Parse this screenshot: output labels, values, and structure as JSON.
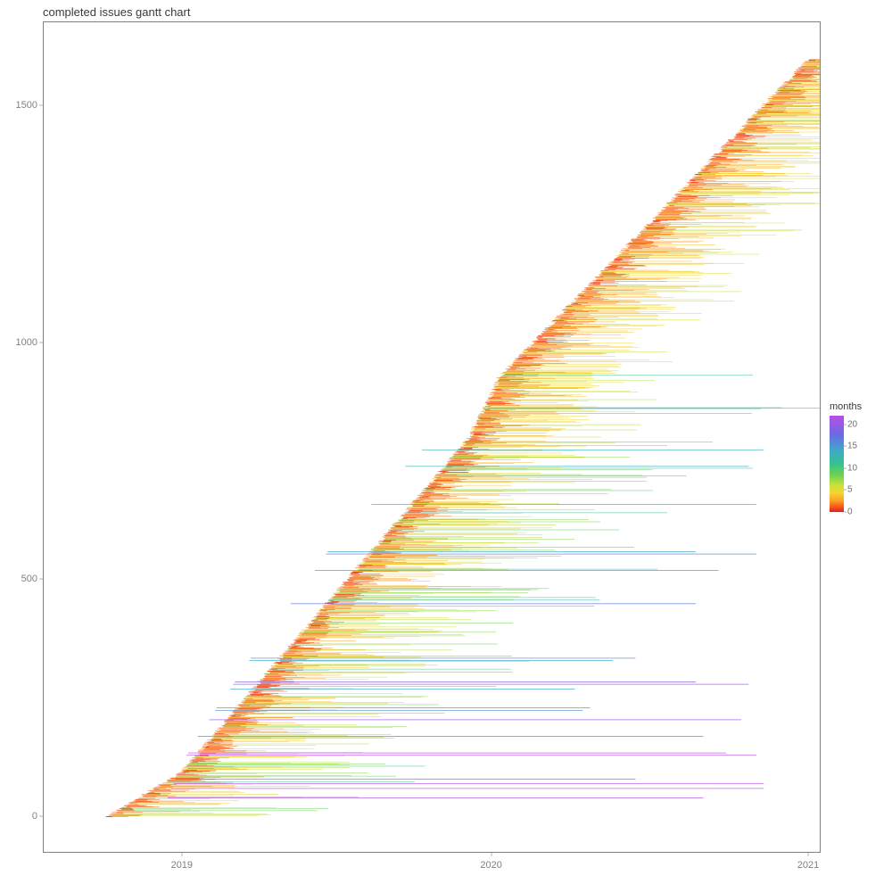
{
  "chart_data": {
    "type": "gantt",
    "title": "completed issues gantt chart",
    "xlabel": "",
    "ylabel": "",
    "x_ticks": [
      "2019",
      "2020",
      "2021"
    ],
    "x_tick_values": [
      0.17,
      0.58,
      1.0
    ],
    "y_ticks": [
      "0",
      "500",
      "1000",
      "1500"
    ],
    "y_tick_values": [
      0,
      500,
      1000,
      1500
    ],
    "ylim": [
      -40,
      1640
    ],
    "legend": {
      "title": "months",
      "ticks": [
        "0",
        "5",
        "10",
        "15",
        "20"
      ],
      "tick_values": [
        0,
        5,
        10,
        15,
        20
      ]
    },
    "n_issues": 1600,
    "series_description": "Each row is one completed issue; bar start = creation date, bar end = completion date, color = duration in months. Start dates ascend roughly linearly from late 2018 to early 2021. Most issues are short (red/orange, <3 months). A subset of early issues (y ≈ 0–600) extend far right with durations 10–22 months (green/blue/purple).",
    "long_tail_bars": [
      {
        "y": 40,
        "start": 0.15,
        "end": 0.86,
        "months": 20
      },
      {
        "y": 60,
        "start": 0.155,
        "end": 0.94,
        "months": 22
      },
      {
        "y": 70,
        "start": 0.158,
        "end": 0.94,
        "months": 22
      },
      {
        "y": 80,
        "start": 0.16,
        "end": 0.77,
        "months": 17
      },
      {
        "y": 130,
        "start": 0.175,
        "end": 0.93,
        "months": 21
      },
      {
        "y": 135,
        "start": 0.177,
        "end": 0.89,
        "months": 20
      },
      {
        "y": 170,
        "start": 0.19,
        "end": 0.86,
        "months": 18
      },
      {
        "y": 205,
        "start": 0.205,
        "end": 0.91,
        "months": 19
      },
      {
        "y": 225,
        "start": 0.213,
        "end": 0.7,
        "months": 14
      },
      {
        "y": 230,
        "start": 0.215,
        "end": 0.71,
        "months": 14
      },
      {
        "y": 270,
        "start": 0.233,
        "end": 0.69,
        "months": 13
      },
      {
        "y": 280,
        "start": 0.237,
        "end": 0.92,
        "months": 19
      },
      {
        "y": 285,
        "start": 0.239,
        "end": 0.85,
        "months": 17
      },
      {
        "y": 330,
        "start": 0.258,
        "end": 0.74,
        "months": 13
      },
      {
        "y": 335,
        "start": 0.26,
        "end": 0.77,
        "months": 14
      },
      {
        "y": 450,
        "start": 0.313,
        "end": 0.85,
        "months": 15
      },
      {
        "y": 520,
        "start": 0.345,
        "end": 0.88,
        "months": 14
      },
      {
        "y": 555,
        "start": 0.36,
        "end": 0.93,
        "months": 15
      },
      {
        "y": 560,
        "start": 0.362,
        "end": 0.85,
        "months": 13
      },
      {
        "y": 660,
        "start": 0.42,
        "end": 0.93,
        "months": 13
      },
      {
        "y": 740,
        "start": 0.465,
        "end": 0.92,
        "months": 12
      },
      {
        "y": 775,
        "start": 0.487,
        "end": 0.94,
        "months": 12
      }
    ]
  }
}
